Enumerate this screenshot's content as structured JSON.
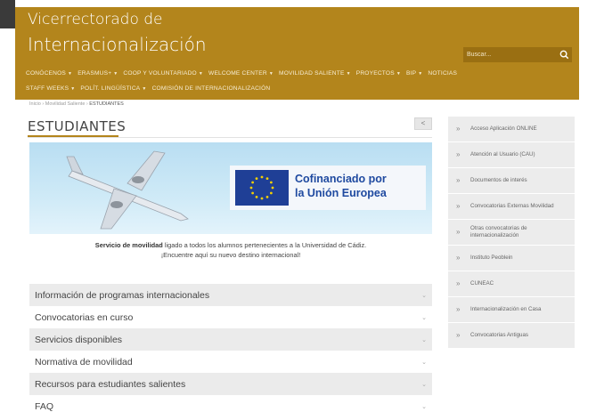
{
  "header": {
    "title_line1": "Vicerrectorado de",
    "title_line2": "Internacionalización",
    "search_placeholder": "Buscar..."
  },
  "nav": {
    "row1": [
      {
        "label": "CONÓCENOS",
        "dropdown": true
      },
      {
        "label": "ERASMUS+",
        "dropdown": true
      },
      {
        "label": "COOP Y VOLUNTARIADO",
        "dropdown": true
      },
      {
        "label": "WELCOME CENTER",
        "dropdown": true
      },
      {
        "label": "MOVILIDAD SALIENTE",
        "dropdown": true
      },
      {
        "label": "PROYECTOS",
        "dropdown": true
      },
      {
        "label": "BIP",
        "dropdown": true
      },
      {
        "label": "NOTICIAS",
        "dropdown": false
      }
    ],
    "row2": [
      {
        "label": "STAFF WEEKS",
        "dropdown": true
      },
      {
        "label": "POLÍT. LINGÜÍSTICA",
        "dropdown": true
      },
      {
        "label": "COMISIÓN DE INTERNACIONALIZACIÓN",
        "dropdown": false
      }
    ]
  },
  "breadcrumb": {
    "home": "Inicio",
    "parent": "Movilidad Saliente",
    "current": "ESTUDIANTES"
  },
  "page": {
    "title": "ESTUDIANTES",
    "share_symbol": "<"
  },
  "banner": {
    "eu_line1": "Cofinanciado por",
    "eu_line2": "la Unión Europea"
  },
  "intro": {
    "bold": "Servicio de movilidad",
    "rest": " ligado a todos los alumnos pertenecientes a la Universidad de Cádiz.",
    "line2": "¡Encuentre aquí su nuevo destino internacional!"
  },
  "accordion": [
    {
      "label": "Información de programas internacionales"
    },
    {
      "label": "Convocatorias en curso"
    },
    {
      "label": "Servicios disponibles"
    },
    {
      "label": "Normativa de movilidad"
    },
    {
      "label": "Recursos para estudiantes salientes"
    },
    {
      "label": "FAQ"
    }
  ],
  "sidebar": [
    {
      "label": "Acceso Aplicación ONLINE"
    },
    {
      "label": "Atención al Usuario (CAU)"
    },
    {
      "label": "Documentos de interés"
    },
    {
      "label": "Convocatorias Externas Movilidad"
    },
    {
      "label": "Otras convocatorias de internacionalización"
    },
    {
      "label": "Instituto Peoblein"
    },
    {
      "label": "CUNEAC"
    },
    {
      "label": "Internacionalización en Casa"
    },
    {
      "label": "Convocatorias Antiguas"
    }
  ],
  "colors": {
    "brand": "#b3851c",
    "sidebar_bg": "#ececec",
    "eu_blue": "#1f3f96"
  },
  "icons": {
    "search": "search-icon",
    "share": "share-icon",
    "accordion_chevron": "chevron-down-icon",
    "sidebar_bullet": "double-chevron-right-icon"
  }
}
